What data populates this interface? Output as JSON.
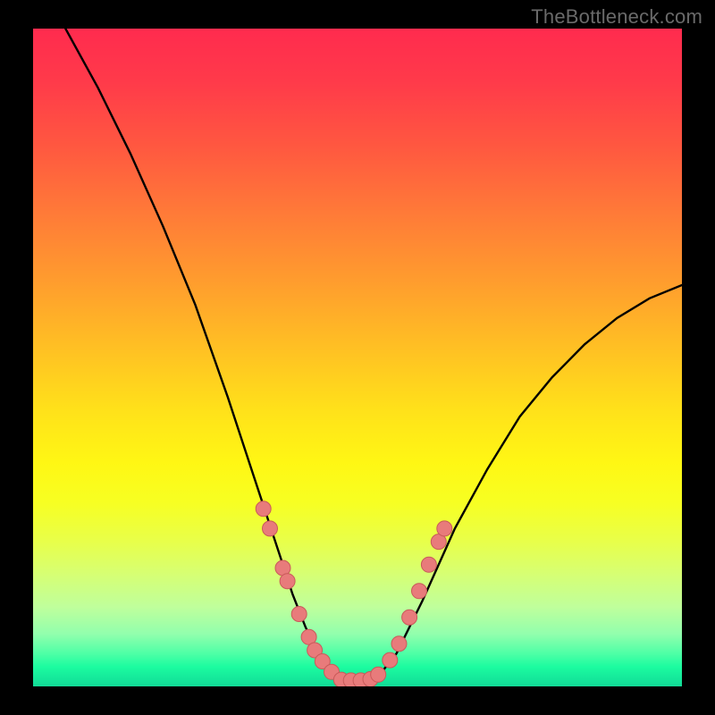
{
  "attribution": "TheBottleneck.com",
  "colors": {
    "frame": "#000000",
    "marker_fill": "#e87b7b",
    "marker_stroke": "#c95a5a",
    "curve": "#000000",
    "gradient_top": "#ff2b4e",
    "gradient_bottom": "#12da96"
  },
  "chart_data": {
    "type": "line",
    "title": "",
    "xlabel": "",
    "ylabel": "",
    "xlim": [
      0,
      100
    ],
    "ylim": [
      0,
      100
    ],
    "note": "Axes are unlabeled in the source image; x is an implicit horizontal parameter (approx. 0–100) and y is the vertical value read from the plot where 0 = bottom and 100 = top.",
    "series": [
      {
        "name": "curve",
        "style": "line",
        "x": [
          5,
          10,
          15,
          20,
          25,
          30,
          34,
          38,
          40,
          42,
          44,
          46,
          48,
          50,
          52,
          54,
          56,
          60,
          65,
          70,
          75,
          80,
          85,
          90,
          95,
          100
        ],
        "y": [
          100,
          91,
          81,
          70,
          58,
          44,
          32,
          20,
          14,
          9,
          5,
          2.5,
          1.2,
          0.8,
          1.2,
          2.5,
          5,
          13,
          24,
          33,
          41,
          47,
          52,
          56,
          59,
          61
        ]
      },
      {
        "name": "left-markers",
        "style": "scatter",
        "x": [
          35.5,
          36.5,
          38.5,
          39.2,
          41.0,
          42.5,
          43.4,
          44.6,
          46.0
        ],
        "y": [
          27.0,
          24.0,
          18.0,
          16.0,
          11.0,
          7.5,
          5.5,
          3.8,
          2.2
        ]
      },
      {
        "name": "bottom-markers",
        "style": "scatter",
        "x": [
          47.5,
          49.0,
          50.5,
          52.0,
          53.2
        ],
        "y": [
          1.0,
          0.9,
          0.9,
          1.1,
          1.8
        ]
      },
      {
        "name": "right-markers",
        "style": "scatter",
        "x": [
          55.0,
          56.4,
          58.0,
          59.5,
          61.0,
          62.5,
          63.4
        ],
        "y": [
          4.0,
          6.5,
          10.5,
          14.5,
          18.5,
          22.0,
          24.0
        ]
      }
    ]
  }
}
